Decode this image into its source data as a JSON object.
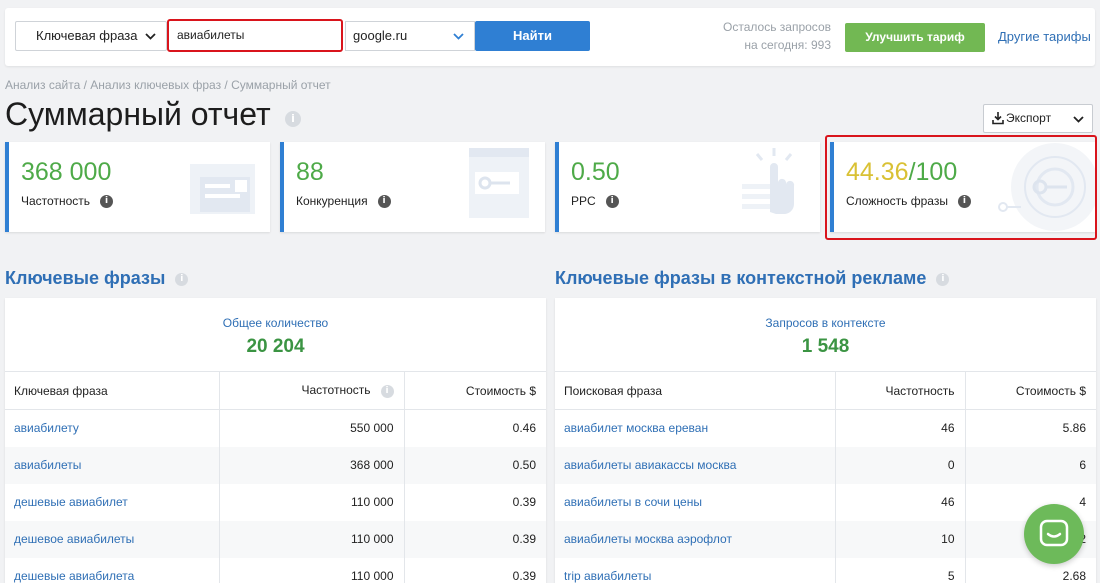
{
  "search": {
    "type_label": "Ключевая фраза",
    "query": "авиабилеты",
    "engine": "google.ru",
    "find_label": "Найти"
  },
  "quota": {
    "line1": "Осталось запросов",
    "line2": "на сегодня: 993"
  },
  "plans": {
    "upgrade_label": "Улучшить тариф",
    "other_label": "Другие тарифы"
  },
  "breadcrumb": "Анализ сайта / Анализ ключевых фраз / Суммарный отчет",
  "page_title": "Суммарный отчет",
  "export_label": "Экспорт",
  "cards": [
    {
      "value": "368 000",
      "label": "Частотность"
    },
    {
      "value": "88",
      "label": "Конкуренция"
    },
    {
      "value": "0.50",
      "label": "PPC"
    },
    {
      "value_main": "44.36",
      "value_rest": "/100",
      "label": "Сложность фразы"
    }
  ],
  "keywords": {
    "title": "Ключевые фразы",
    "total_label": "Общее количество",
    "total_value": "20 204",
    "columns": [
      "Ключевая фраза",
      "Частотность",
      "Стоимость $"
    ],
    "rows": [
      [
        "авиабилету",
        "550 000",
        "0.46"
      ],
      [
        "авиабилеты",
        "368 000",
        "0.50"
      ],
      [
        "дешевые авиабилет",
        "110 000",
        "0.39"
      ],
      [
        "дешевое авиабилеты",
        "110 000",
        "0.39"
      ],
      [
        "дешевые авиабилета",
        "110 000",
        "0.39"
      ]
    ]
  },
  "context": {
    "title": "Ключевые фразы в контекстной рекламе",
    "total_label": "Запросов в контексте",
    "total_value": "1 548",
    "columns": [
      "Поисковая фраза",
      "Частотность",
      "Стоимость $"
    ],
    "rows": [
      [
        "авиабилет москва ереван",
        "46",
        "5.86"
      ],
      [
        "авиабилеты авиакассы москва",
        "0",
        "6"
      ],
      [
        "авиабилеты в сочи цены",
        "46",
        "4"
      ],
      [
        "авиабилеты москва аэрофлот",
        "10",
        "2"
      ],
      [
        "trip авиабилеты",
        "5",
        "2.68"
      ]
    ]
  },
  "colors": {
    "accent": "#2f7fd3",
    "green": "#4eaa48",
    "highlight": "#d9141c",
    "link": "#2f6fb5",
    "yellow": "#d9c134"
  },
  "icons": [
    "chevron-down-icon",
    "info-icon",
    "download-icon",
    "chat-icon"
  ]
}
